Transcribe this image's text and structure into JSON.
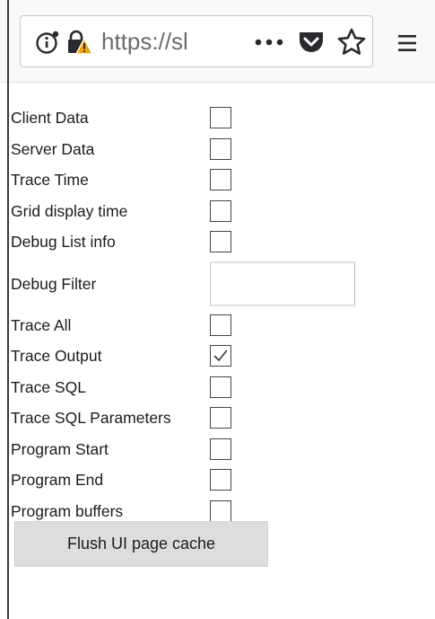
{
  "browser": {
    "url_display": "https://sl",
    "icons": {
      "info": "info-icon",
      "insecure": "insecure-lock-icon",
      "page_actions": "more-icon",
      "pocket": "pocket-icon",
      "bookmark": "star-icon",
      "menu": "hamburger-menu-icon"
    }
  },
  "options": {
    "rows": [
      {
        "label": "Client Data",
        "type": "checkbox",
        "checked": false
      },
      {
        "label": "Server Data",
        "type": "checkbox",
        "checked": false
      },
      {
        "label": "Trace Time",
        "type": "checkbox",
        "checked": false
      },
      {
        "label": "Grid display time",
        "type": "checkbox",
        "checked": false
      },
      {
        "label": "Debug List info",
        "type": "checkbox",
        "checked": false
      },
      {
        "label": "Debug Filter",
        "type": "text",
        "value": "",
        "placeholder": ""
      },
      {
        "label": "Trace All",
        "type": "checkbox",
        "checked": false
      },
      {
        "label": "Trace Output",
        "type": "checkbox",
        "checked": true
      },
      {
        "label": "Trace SQL",
        "type": "checkbox",
        "checked": false
      },
      {
        "label": "Trace SQL Parameters",
        "type": "checkbox",
        "checked": false
      },
      {
        "label": "Program Start",
        "type": "checkbox",
        "checked": false
      },
      {
        "label": "Program End",
        "type": "checkbox",
        "checked": false
      },
      {
        "label": "Program buffers",
        "type": "checkbox",
        "checked": false
      }
    ]
  },
  "actions": {
    "flush_label": "Flush UI page cache"
  },
  "colors": {
    "insecure_warning": "#f0a30a",
    "toolbar_icon": "#2a2a2e"
  }
}
